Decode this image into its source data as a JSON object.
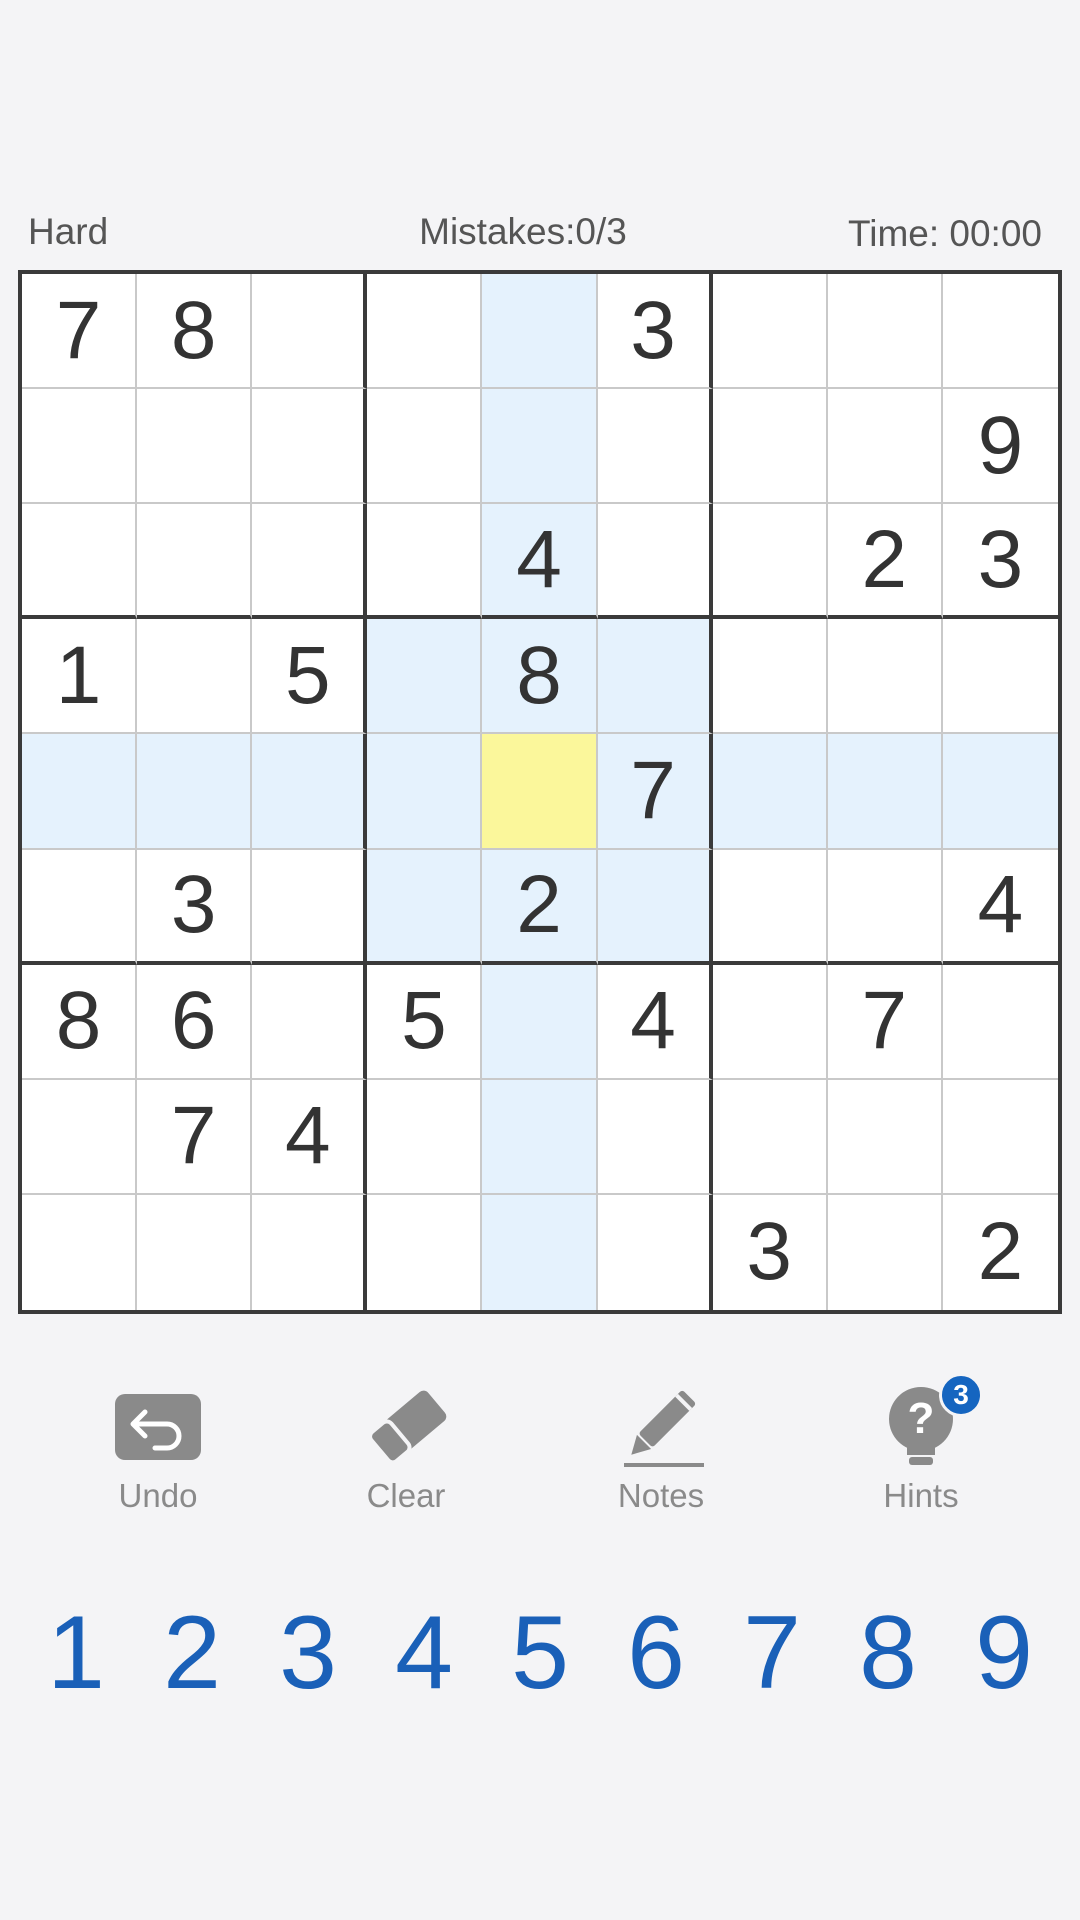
{
  "header": {
    "difficulty": "Hard",
    "mistakes": "Mistakes:0/3",
    "timer": "Time: 00:00"
  },
  "board": {
    "cells": [
      [
        "7",
        "8",
        "",
        "",
        "",
        "3",
        "",
        "",
        ""
      ],
      [
        "",
        "",
        "",
        "",
        "",
        "",
        "",
        "",
        "9"
      ],
      [
        "",
        "",
        "",
        "",
        "4",
        "",
        "",
        "2",
        "3"
      ],
      [
        "1",
        "",
        "5",
        "",
        "8",
        "",
        "",
        "",
        ""
      ],
      [
        "",
        "",
        "",
        "",
        "",
        "7",
        "",
        "",
        ""
      ],
      [
        "",
        "3",
        "",
        "",
        "2",
        "",
        "",
        "",
        "4"
      ],
      [
        "8",
        "6",
        "",
        "5",
        "",
        "4",
        "",
        "7",
        ""
      ],
      [
        "",
        "7",
        "4",
        "",
        "",
        "",
        "",
        "",
        ""
      ],
      [
        "",
        "",
        "",
        "",
        "",
        "",
        "3",
        "",
        "2"
      ]
    ],
    "selected": {
      "row": 4,
      "col": 4
    },
    "colors": {
      "highlight": "#e5f2fd",
      "selected": "#fbf79b",
      "given": "#333333"
    }
  },
  "tools": {
    "undo": {
      "label": "Undo",
      "icon": "undo-icon"
    },
    "clear": {
      "label": "Clear",
      "icon": "eraser-icon"
    },
    "notes": {
      "label": "Notes",
      "icon": "pencil-icon"
    },
    "hints": {
      "label": "Hints",
      "icon": "lightbulb-question-icon",
      "badge": "3"
    }
  },
  "numpad": {
    "keys": [
      "1",
      "2",
      "3",
      "4",
      "5",
      "6",
      "7",
      "8",
      "9"
    ],
    "color": "#1a60b8"
  }
}
